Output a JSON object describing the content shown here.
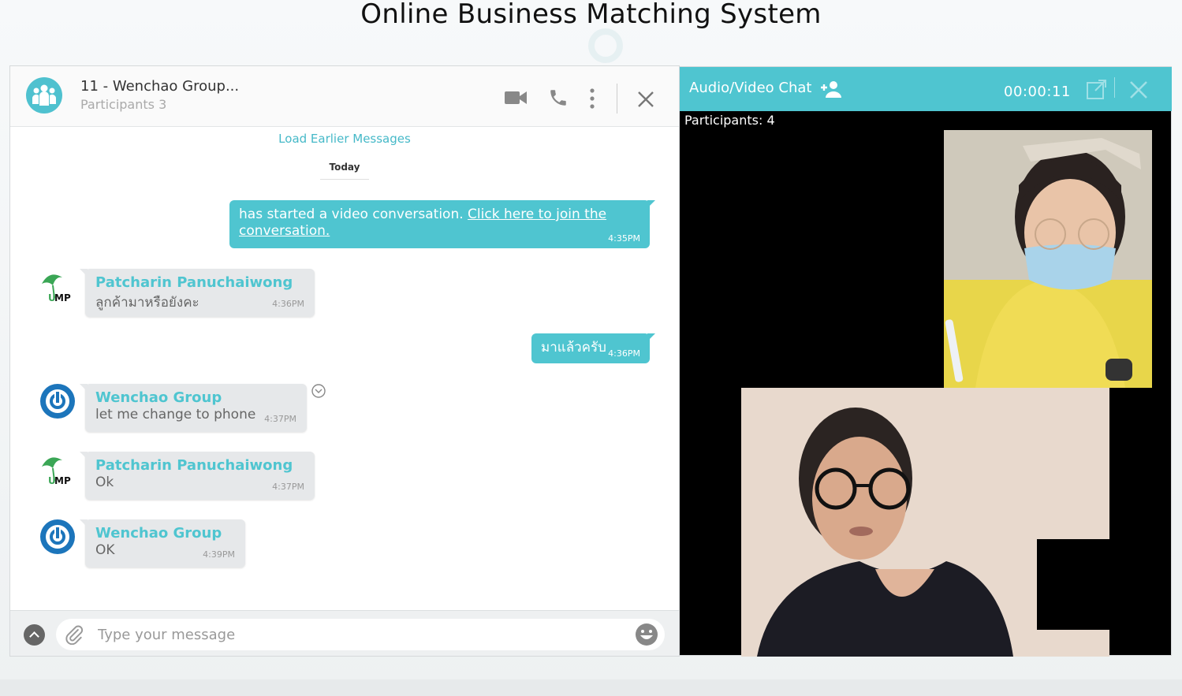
{
  "page": {
    "title": "Online Business Matching System"
  },
  "chat": {
    "title": "11 - Wenchao Group...",
    "subtitle": "Participants 3",
    "load_earlier": "Load Earlier Messages",
    "date_divider": "Today",
    "messages": [
      {
        "direction": "out",
        "text": "has started a video conversation. ",
        "link": "Click here to join the conversation.",
        "time": "4:35PM"
      },
      {
        "direction": "in",
        "avatar": "ump-logo-icon",
        "sender": "Patcharin Panuchaiwong",
        "text": "ลูกค้ามาหรือยังคะ",
        "time": "4:36PM"
      },
      {
        "direction": "out",
        "text": "มาแล้วครับ",
        "time": "4:36PM"
      },
      {
        "direction": "in",
        "avatar": "wenchao-power-icon",
        "sender": "Wenchao Group",
        "text": "let me change to phone",
        "time": "4:37PM"
      },
      {
        "direction": "in",
        "avatar": "ump-logo-icon",
        "sender": "Patcharin Panuchaiwong",
        "text": "Ok",
        "time": "4:37PM"
      },
      {
        "direction": "in",
        "avatar": "wenchao-power-icon",
        "sender": "Wenchao Group",
        "text": "OK",
        "time": "4:39PM"
      }
    ],
    "composer": {
      "placeholder": "Type your message"
    }
  },
  "video": {
    "title": "Audio/Video Chat",
    "timer": "00:00:11",
    "participants_label": "Participants: 4"
  },
  "colors": {
    "accent": "#4fc5d0",
    "wenchao_blue": "#1c75bb",
    "ump_green": "#3aa655"
  }
}
